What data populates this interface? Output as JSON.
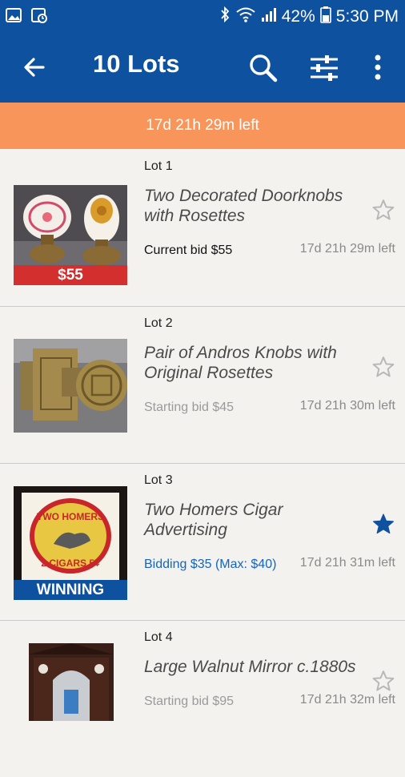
{
  "status_bar": {
    "battery_percent": "42%",
    "time": "5:30 PM",
    "icons": [
      "image-icon",
      "image-clock-icon",
      "bluetooth-icon",
      "wifi-icon",
      "signal-icon",
      "battery-icon"
    ]
  },
  "app_bar": {
    "title": "10 Lots",
    "icons": [
      "back-arrow-icon",
      "search-icon",
      "filter-sliders-icon",
      "more-vertical-icon"
    ],
    "color": "#0e519f"
  },
  "timer_banner": {
    "text": "17d 21h 29m left",
    "color": "#f7955a"
  },
  "lots": [
    {
      "lot_label": "Lot 1",
      "title": "Two Decorated Doorknobs with Rosettes",
      "bid_text": "Current bid $55",
      "bid_color": "#111111",
      "time_left": "17d 21h 29m left",
      "starred": false,
      "thumb_label": "$55",
      "thumb_label_color": "#d32f2f"
    },
    {
      "lot_label": "Lot 2",
      "title": "Pair of Andros Knobs with Original Rosettes",
      "bid_text": "Starting bid $45",
      "bid_color": "#9a9a9a",
      "time_left": "17d 21h 30m left",
      "starred": false,
      "thumb_label": "",
      "thumb_label_color": ""
    },
    {
      "lot_label": "Lot 3",
      "title": "Two Homers Cigar Advertising",
      "bid_text": "Bidding $35 (Max: $40)",
      "bid_color": "#1565c0",
      "time_left": "17d 21h 31m left",
      "starred": true,
      "thumb_label": "WINNING",
      "thumb_label_color": "#0e519f",
      "thumb_sign_text_top": "TWO HOMERS",
      "thumb_sign_text_bottom": "2 CIGARS 5¢"
    },
    {
      "lot_label": "Lot 4",
      "title": "Large Walnut Mirror c.1880s",
      "bid_text": "Starting bid $95",
      "bid_color": "#9a9a9a",
      "time_left": "17d 21h 32m left",
      "starred": false,
      "thumb_label": "",
      "thumb_label_color": ""
    }
  ]
}
